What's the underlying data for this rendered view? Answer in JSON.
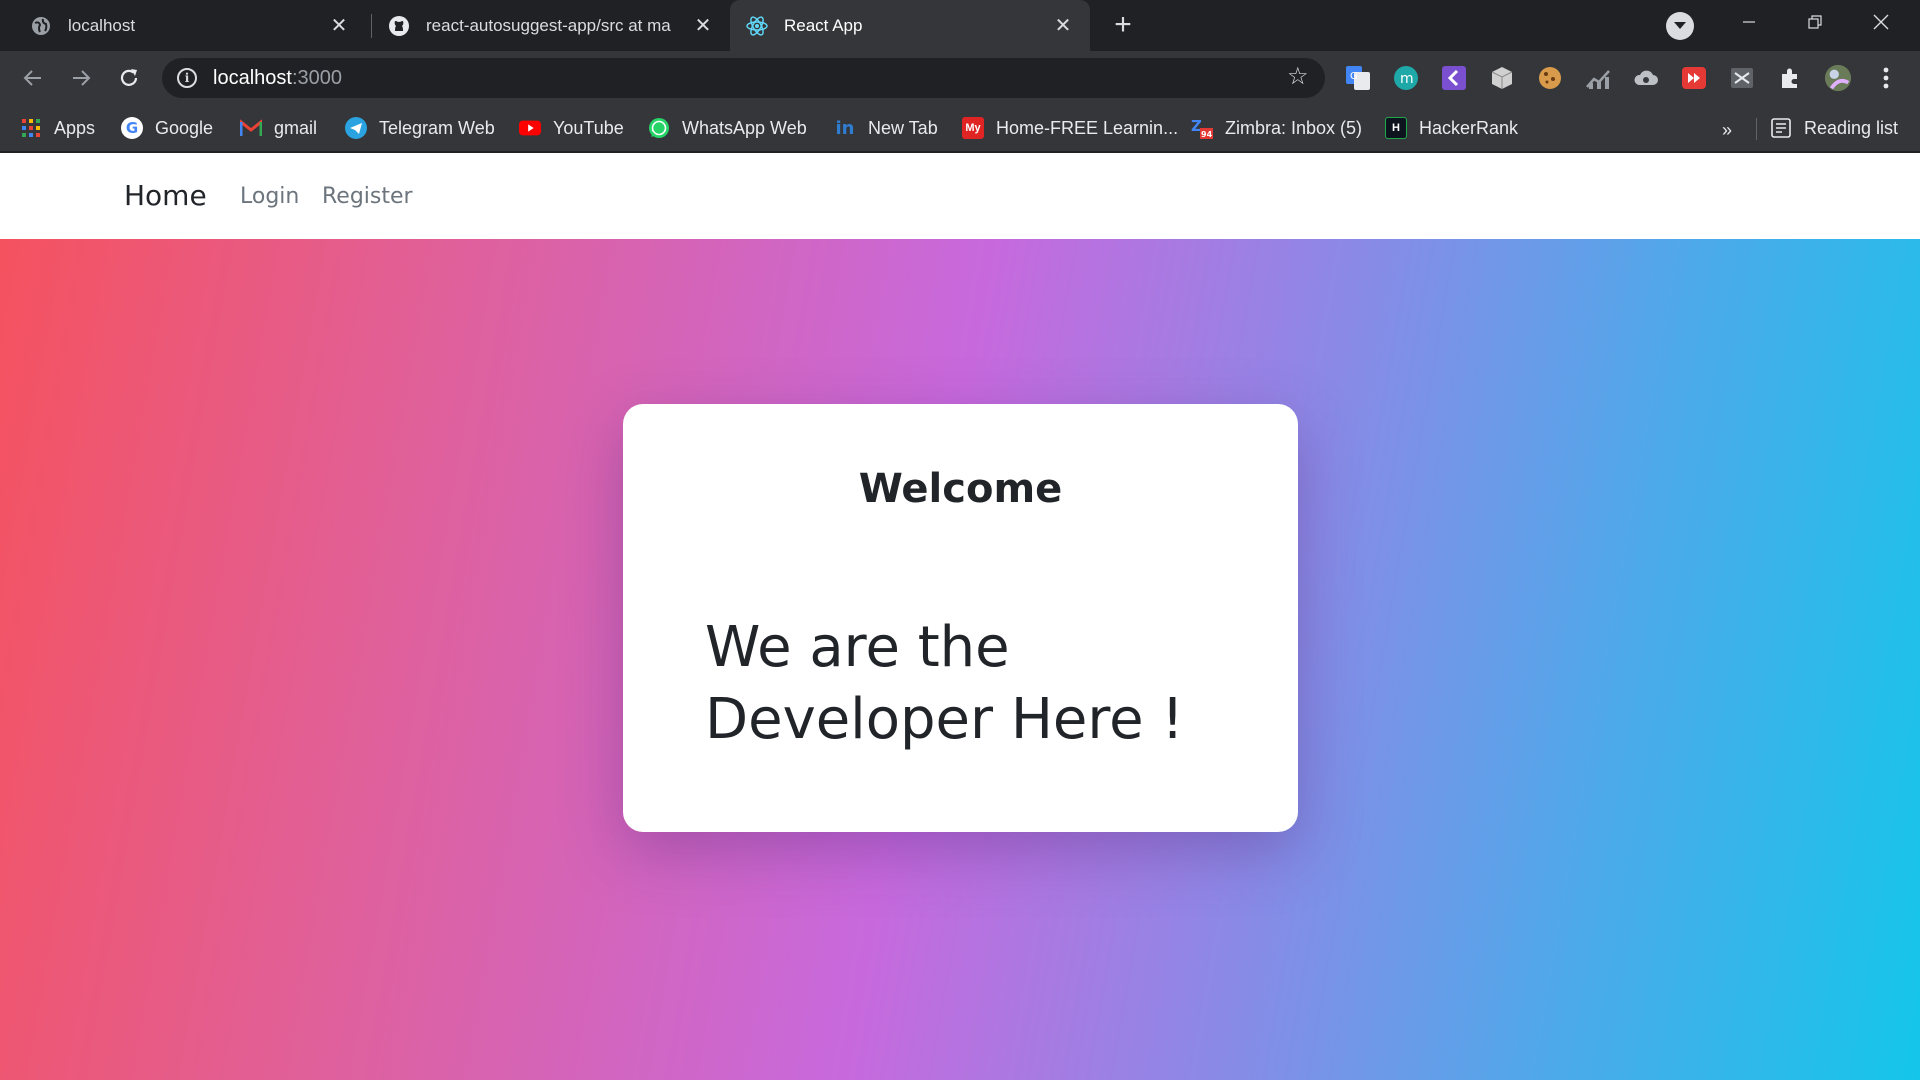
{
  "browser": {
    "tabs": [
      {
        "title": "localhost",
        "icon": "globe-icon"
      },
      {
        "title": "react-autosuggest-app/src at ma",
        "icon": "github-icon"
      },
      {
        "title": "React App",
        "icon": "react-icon",
        "active": true
      }
    ],
    "address": {
      "host": "localhost",
      "port": ":3000"
    },
    "bookmarks": [
      {
        "label": "Apps",
        "icon": "apps-grid-icon"
      },
      {
        "label": "Google",
        "icon": "google-icon"
      },
      {
        "label": "gmail",
        "icon": "gmail-icon"
      },
      {
        "label": "Telegram Web",
        "icon": "telegram-icon"
      },
      {
        "label": "YouTube",
        "icon": "youtube-icon"
      },
      {
        "label": "WhatsApp Web",
        "icon": "whatsapp-icon"
      },
      {
        "label": "New Tab",
        "icon": "linkedin-icon"
      },
      {
        "label": "Home-FREE Learnin...",
        "icon": "my-icon"
      },
      {
        "label": "Zimbra: Inbox (5)",
        "icon": "zimbra-icon"
      },
      {
        "label": "HackerRank",
        "icon": "hackerrank-icon"
      }
    ],
    "more_bookmarks": "»",
    "reading_list": "Reading list"
  },
  "app": {
    "nav": {
      "brand": "Home",
      "login": "Login",
      "register": "Register"
    },
    "card": {
      "title": "Welcome",
      "text": "We are the Developer Here !"
    }
  },
  "colors": {
    "gradient_start": "#f5525f",
    "gradient_mid": "#c769dd",
    "gradient_end": "#14c6ea"
  }
}
